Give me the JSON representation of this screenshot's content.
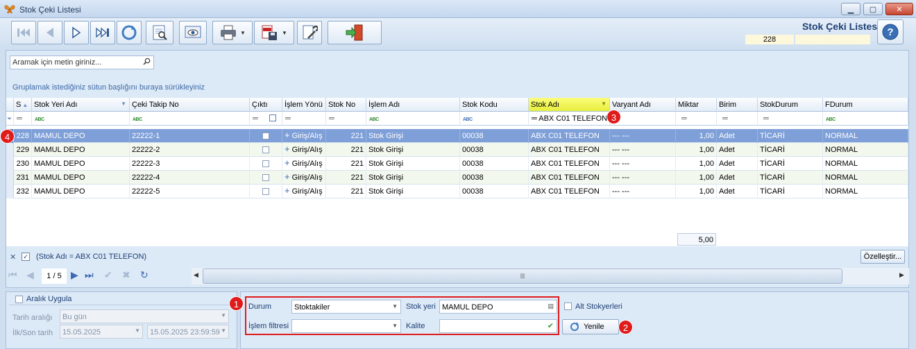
{
  "window": {
    "title": "Stok Çeki Listesi"
  },
  "header": {
    "title": "Stok Çeki Listesi",
    "count": "228"
  },
  "search": {
    "placeholder": "Aramak için metin giriniz..."
  },
  "group_hint": "Gruplamak istediğiniz sütun başlığını buraya sürükleyiniz",
  "columns": [
    "S",
    "Stok Yeri Adı",
    "Çeki Takip No",
    "Çıktı",
    "İşlem Yönü",
    "Stok No",
    "İşlem Adı",
    "Stok Kodu",
    "Stok Adı",
    "Varyant Adı",
    "Miktar",
    "Birim",
    "StokDurum",
    "FDurum"
  ],
  "filter_row": {
    "stok_adi": "ABX C01 TELEFON"
  },
  "rows": [
    {
      "s": "228",
      "stok_yeri": "MAMUL DEPO",
      "takip_no": "22222-1",
      "yon": "Giriş/Alış",
      "stok_no": "221",
      "islem": "Stok Girişi",
      "kod": "00038",
      "stok_adi": "ABX C01 TELEFON",
      "varyant": "--- ---",
      "miktar": "1,00",
      "birim": "Adet",
      "stok_durum": "TİCARİ",
      "fdurum": "NORMAL"
    },
    {
      "s": "229",
      "stok_yeri": "MAMUL DEPO",
      "takip_no": "22222-2",
      "yon": "Giriş/Alış",
      "stok_no": "221",
      "islem": "Stok Girişi",
      "kod": "00038",
      "stok_adi": "ABX C01 TELEFON",
      "varyant": "--- ---",
      "miktar": "1,00",
      "birim": "Adet",
      "stok_durum": "TİCARİ",
      "fdurum": "NORMAL"
    },
    {
      "s": "230",
      "stok_yeri": "MAMUL DEPO",
      "takip_no": "22222-3",
      "yon": "Giriş/Alış",
      "stok_no": "221",
      "islem": "Stok Girişi",
      "kod": "00038",
      "stok_adi": "ABX C01 TELEFON",
      "varyant": "--- ---",
      "miktar": "1,00",
      "birim": "Adet",
      "stok_durum": "TİCARİ",
      "fdurum": "NORMAL"
    },
    {
      "s": "231",
      "stok_yeri": "MAMUL DEPO",
      "takip_no": "22222-4",
      "yon": "Giriş/Alış",
      "stok_no": "221",
      "islem": "Stok Girişi",
      "kod": "00038",
      "stok_adi": "ABX C01 TELEFON",
      "varyant": "--- ---",
      "miktar": "1,00",
      "birim": "Adet",
      "stok_durum": "TİCARİ",
      "fdurum": "NORMAL"
    },
    {
      "s": "232",
      "stok_yeri": "MAMUL DEPO",
      "takip_no": "22222-5",
      "yon": "Giriş/Alış",
      "stok_no": "221",
      "islem": "Stok Girişi",
      "kod": "00038",
      "stok_adi": "ABX C01 TELEFON",
      "varyant": "--- ---",
      "miktar": "1,00",
      "birim": "Adet",
      "stok_durum": "TİCARİ",
      "fdurum": "NORMAL"
    }
  ],
  "summary": {
    "miktar_total": "5,00"
  },
  "filter_bar": {
    "text": "(Stok Adı = ABX C01 TELEFON)",
    "close": "✕",
    "check": "✓"
  },
  "customize_label": "Özelleştir...",
  "navigator": {
    "position": "1 / 5"
  },
  "date_panel": {
    "range_label": "Aralık Uygula",
    "tarih_araligi_label": "Tarih aralığı",
    "tarih_araligi_value": "Bu gün",
    "ilk_son_label": "İlk/Son tarih",
    "ilk_tarih": "15.05.2025",
    "son_tarih": "15.05.2025 23:59:59"
  },
  "options": {
    "durum_label": "Durum",
    "durum_value": "Stoktakiler",
    "stok_yeri_label": "Stok yeri",
    "stok_yeri_value": "MAMUL DEPO",
    "islem_filtresi_label": "İşlem filtresi",
    "islem_filtresi_value": "",
    "kalite_label": "Kalite",
    "kalite_value": "",
    "alt_stokyerleri_label": "Alt Stokyerleri",
    "refresh_label": "Yenile"
  },
  "badges": [
    "1",
    "2",
    "3",
    "4"
  ],
  "icons": [
    "app-butterfly-icon",
    "first-record-icon",
    "prev-record-icon",
    "next-record-icon",
    "last-record-icon",
    "refresh-icon",
    "preview-icon",
    "view-icon",
    "print-icon",
    "pdf-save-icon",
    "tools-icon",
    "exit-icon",
    "help-icon",
    "search-icon",
    "filter-icon"
  ],
  "colors": {
    "selected_row": "#7e9fd8",
    "highlight_header": "#e7ee3d",
    "badge": "#e01b1b"
  }
}
